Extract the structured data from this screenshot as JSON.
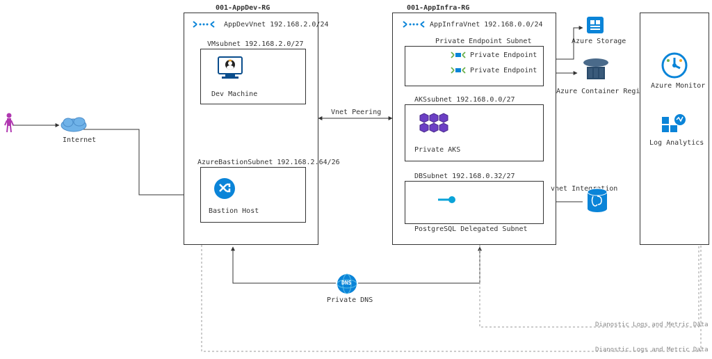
{
  "rg_dev_title": "001-AppDev-RG",
  "rg_infra_title": "001-AppInfra-RG",
  "vnet_dev": "AppDevVnet 192.168.2.0/24",
  "vnet_infra": "AppInfraVnet 192.168.0.0/24",
  "subnet_vm": "VMsubnet 192.168.2.0/27",
  "subnet_bastion": "AzureBastionSubnet 192.168.2.64/26",
  "subnet_pe": "Private Endpoint Subnet",
  "subnet_aks": "AKSsubnet 192.168.0.0/27",
  "subnet_db": "DBSubnet 192.168.0.32/27",
  "pe1": "Private Endpoint",
  "pe2": "Private Endpoint",
  "dev_machine": "Dev Machine",
  "bastion": "Bastion Host",
  "private_aks": "Private AKS",
  "pg_subnet": "PostgreSQL Delegated Subnet",
  "internet": "Internet",
  "vnet_peering": "Vnet Peering",
  "vnet_integration": "vnet Integration",
  "private_dns": "Private DNS",
  "dns_short": "DNS",
  "storage": "Azure Storage",
  "acr": "Azure Container Registry",
  "monitor": "Azure Monitor",
  "log_analytics": "Log Analytics",
  "diag1": "Dianostic Logs and Metric Data",
  "diag2": "Dianostic Logs and Metric Data"
}
